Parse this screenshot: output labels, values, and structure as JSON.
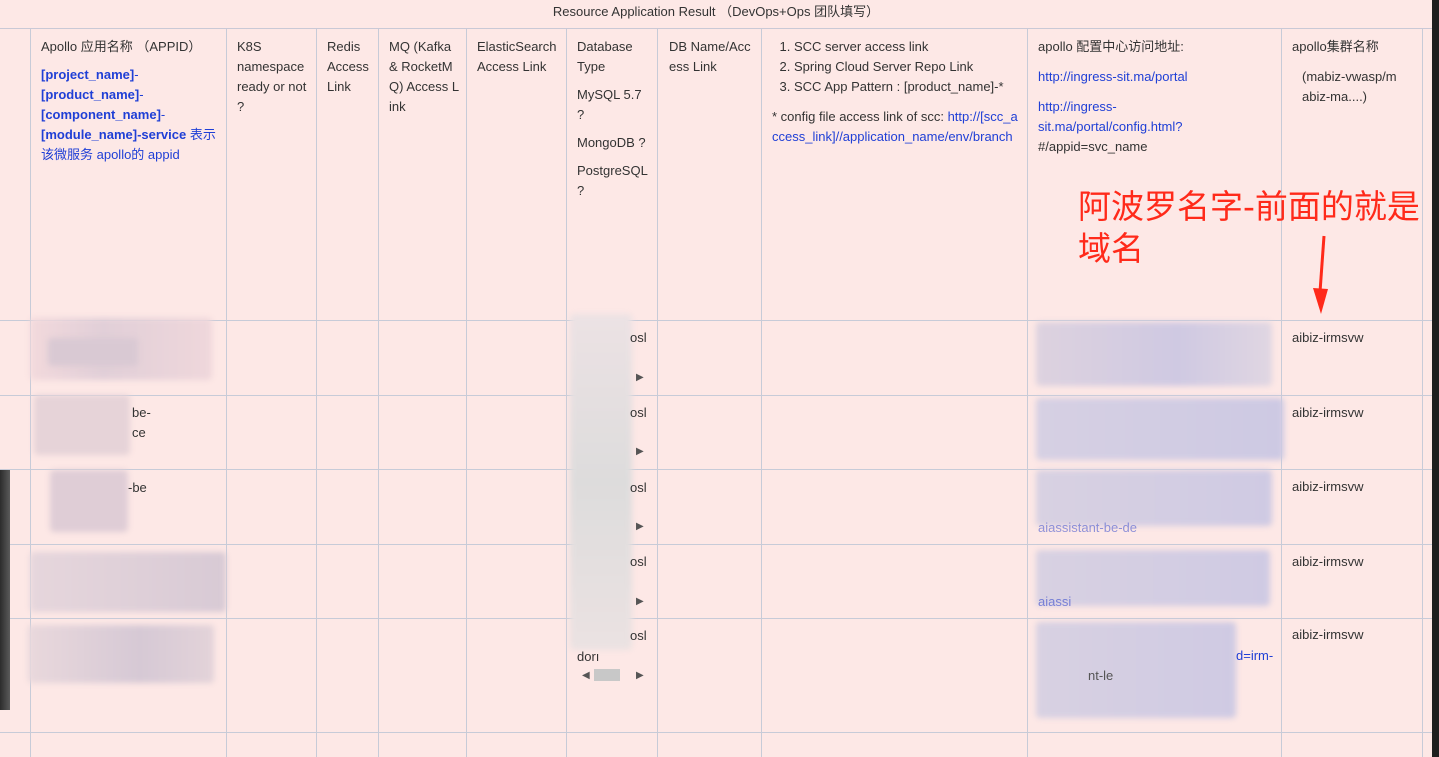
{
  "banner": "Resource Application Result  （DevOps+Ops 团队填写）",
  "headers": {
    "apollo": {
      "title": "Apollo 应用名称 （APPID）",
      "p1": "[project_name]",
      "p2": "[product_name]",
      "p3": "[component_name]",
      "p4": "[module_name]-service",
      "suffix": " 表示该微服务 apollo的 appid"
    },
    "k8s": "K8S namespace ready or not ?",
    "redis": "Redis Access Link",
    "mq": "MQ (Kafka & RocketMQ) Access Link",
    "es": "ElasticSearch Access Link",
    "db": {
      "title": "Database Type",
      "o1": "MySQL 5.7 ?",
      "o2": "MongoDB ?",
      "o3": "PostgreSQL ?"
    },
    "dbname": "DB Name/Access Link",
    "scc": {
      "i1": "SCC server access link",
      "i2": "Spring Cloud Server Repo Link",
      "i3": "SCC App Pattern : [product_name]-*",
      "note_prefix": "*  config file access link of scc: ",
      "note_link": "http://[scc_access_link]//application_name/env/branch"
    },
    "apollo_addr": {
      "title": "apollo 配置中心访问地址:",
      "l1": "http://ingress-sit.ma/portal",
      "l2": "http://ingress-sit.ma/portal/config.html?",
      "l2b": "#/appid=svc_name"
    },
    "cluster": {
      "title": "apollo集群名称",
      "sub": "(mabiz-vwasp/mabiz-ma....)"
    }
  },
  "annotation": "阿波罗名字-前面的就是域名",
  "rows": [
    {
      "cluster": "aibiz-irmsvw"
    },
    {
      "cluster": "aibiz-irmsvw"
    },
    {
      "cluster": "aibiz-irmsvw"
    },
    {
      "cluster": "aibiz-irmsvw"
    },
    {
      "cluster": "aibiz-irmsvw"
    }
  ],
  "partials": {
    "r1_db": "osl",
    "r2_db": "osl",
    "r3_db": "osl",
    "r4_db": "osl",
    "r5_db": "osl",
    "r2_app_a": "be-",
    "r2_app_b": "ce",
    "r3_app": "-be",
    "r5_db_b": "dorı",
    "r5_addr": "d=irm-",
    "r5_addr_b": "nt-le",
    "r4_addr": "aiassi",
    "r3_addr": "aiassistant-be-de"
  },
  "colors": {
    "link": "#1f3fd6",
    "annotation": "#ff2a1a",
    "background": "#fde8e6"
  }
}
